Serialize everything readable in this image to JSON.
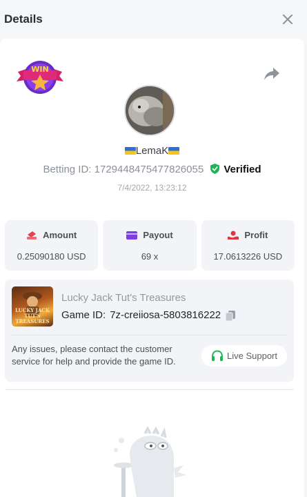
{
  "header": {
    "title": "Details"
  },
  "icons": {
    "close": "close-icon",
    "share": "share-icon",
    "copy": "copy-icon",
    "headset": "headset-icon",
    "verified": "shield-check-icon"
  },
  "badge": {
    "text": "WIN"
  },
  "user": {
    "name": "LemaK"
  },
  "bet": {
    "label": "Betting ID:",
    "id": "1729448475477826055",
    "verified": "Verified",
    "date": "7/4/2022, 13:23:12"
  },
  "stats": [
    {
      "label": "Amount",
      "value": "0.25090180 USD",
      "color": "#e8424f"
    },
    {
      "label": "Payout",
      "value": "69 x",
      "color": "#7b3fe4"
    },
    {
      "label": "Profit",
      "value": "17.0613226 USD",
      "color": "#e0363f"
    }
  ],
  "game": {
    "name": "Lucky Jack Tut's Treasures",
    "thumb_text_1": "LUCKY JACK",
    "thumb_text_2": "TUT'S TREASURES",
    "id_label": "Game ID:",
    "id": "7z-creiiosa-5803816222"
  },
  "support": {
    "message": "Any issues, please contact the customer service for help and provide the game ID.",
    "button": "Live Support"
  },
  "colors": {
    "accent_green": "#1fb35a",
    "verified_green": "#1fb35a"
  }
}
